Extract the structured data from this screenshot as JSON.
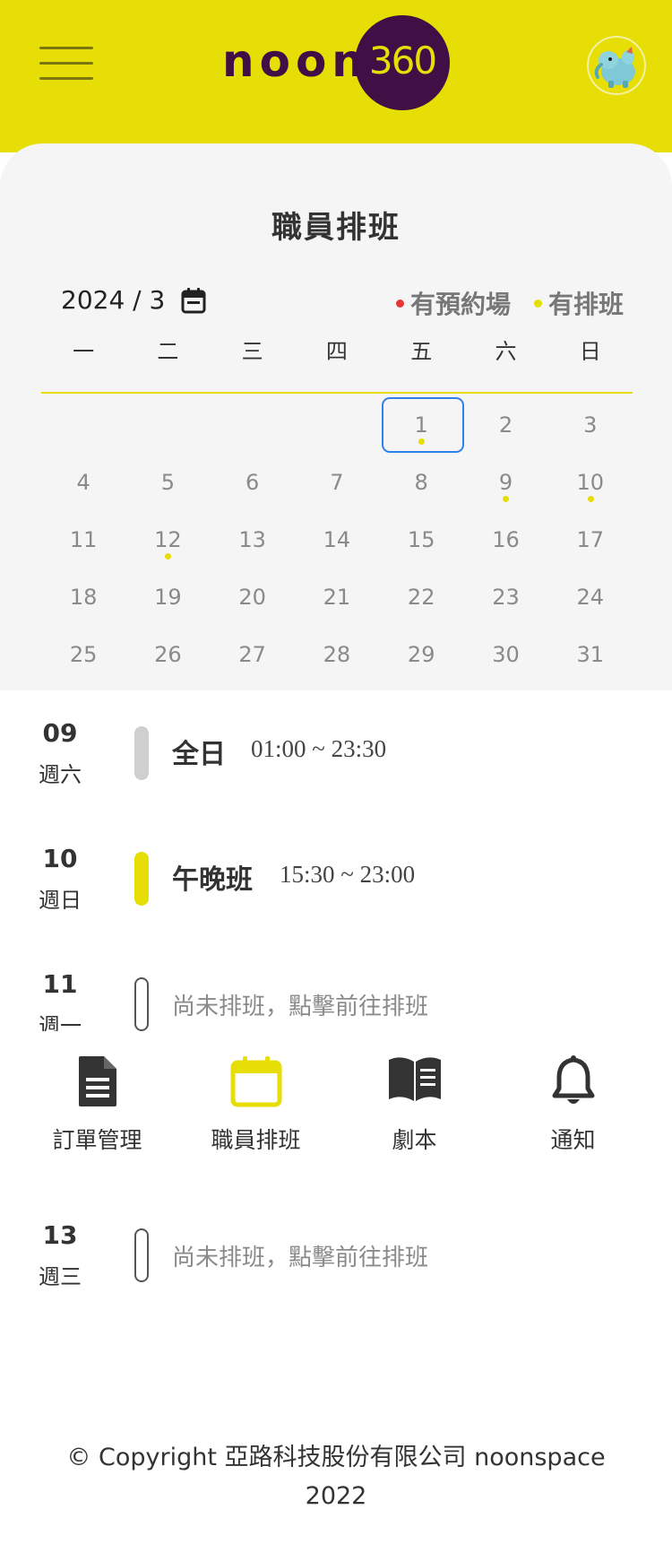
{
  "header": {
    "logo_word": "noon",
    "logo_number": "360",
    "avatar_alt": "user-avatar"
  },
  "calendar": {
    "title": "職員排班",
    "month_label": "2024 / 3",
    "legend": [
      {
        "label": "有預約場",
        "color": "#e53935"
      },
      {
        "label": "有排班",
        "color": "#e6de05"
      }
    ],
    "weekdays": [
      "一",
      "二",
      "三",
      "四",
      "五",
      "六",
      "日"
    ],
    "selected_day": "1",
    "weeks": [
      [
        {
          "d": ""
        },
        {
          "d": ""
        },
        {
          "d": ""
        },
        {
          "d": ""
        },
        {
          "d": "1",
          "dot": true
        },
        {
          "d": "2"
        },
        {
          "d": "3"
        }
      ],
      [
        {
          "d": "4"
        },
        {
          "d": "5"
        },
        {
          "d": "6"
        },
        {
          "d": "7"
        },
        {
          "d": "8"
        },
        {
          "d": "9",
          "dot": true
        },
        {
          "d": "10",
          "dot": true
        }
      ],
      [
        {
          "d": "11"
        },
        {
          "d": "12",
          "dot": true
        },
        {
          "d": "13"
        },
        {
          "d": "14"
        },
        {
          "d": "15"
        },
        {
          "d": "16"
        },
        {
          "d": "17"
        }
      ],
      [
        {
          "d": "18"
        },
        {
          "d": "19"
        },
        {
          "d": "20"
        },
        {
          "d": "21"
        },
        {
          "d": "22"
        },
        {
          "d": "23"
        },
        {
          "d": "24"
        }
      ],
      [
        {
          "d": "25"
        },
        {
          "d": "26"
        },
        {
          "d": "27"
        },
        {
          "d": "28"
        },
        {
          "d": "29"
        },
        {
          "d": "30"
        },
        {
          "d": "31"
        }
      ]
    ]
  },
  "schedule": [
    {
      "day": "09",
      "weekday": "週六",
      "shift": "全日",
      "time": "01:00 ~ 23:30",
      "bar": "grey"
    },
    {
      "day": "10",
      "weekday": "週日",
      "shift": "午晚班",
      "time": "15:30 ~ 23:00",
      "bar": "yellow"
    },
    {
      "day": "11",
      "weekday": "週一",
      "empty_text": "尚未排班，點擊前往排班",
      "bar": "empty"
    },
    {
      "day": "13",
      "weekday": "週三",
      "empty_text": "尚未排班，點擊前往排班",
      "bar": "empty"
    }
  ],
  "nav": [
    {
      "label": "訂單管理",
      "icon": "document-icon",
      "active": false
    },
    {
      "label": "職員排班",
      "icon": "calendar-icon",
      "active": true
    },
    {
      "label": "劇本",
      "icon": "book-icon",
      "active": false
    },
    {
      "label": "通知",
      "icon": "bell-icon",
      "active": false
    }
  ],
  "colors": {
    "brand_yellow": "#e6de05",
    "brand_purple": "#3f0f45",
    "selected_border": "#2f80ed"
  },
  "footer": {
    "line1": "© Copyright 亞路科技股份有限公司 noonspace",
    "line2": "2022"
  }
}
